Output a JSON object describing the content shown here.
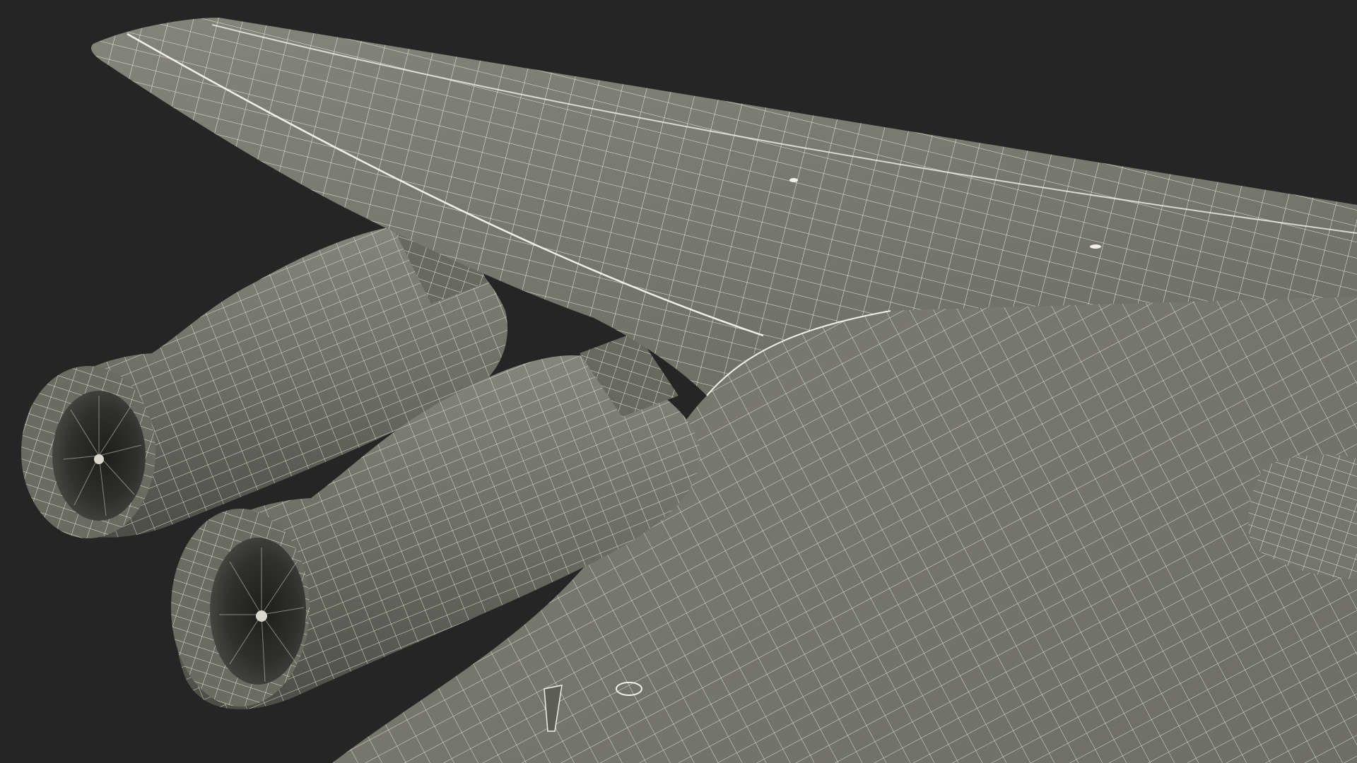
{
  "scene": {
    "subject": "wireframe-render-wing-with-two-engines",
    "colors": {
      "background": "#252525",
      "surface": "#7b7c70",
      "surface_dark": "#5d5e54",
      "surface_shadow": "#45463f",
      "wire": "#f2f1e6",
      "engine_interior": "#2e2f2b"
    }
  }
}
